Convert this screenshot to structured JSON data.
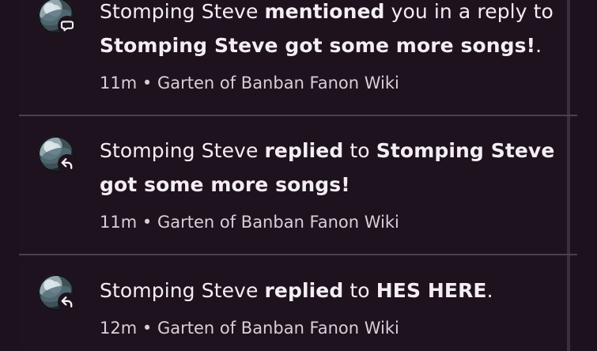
{
  "notifications": [
    {
      "actor": "Stomping Steve",
      "action": "mentioned",
      "middle": "you in a reply to",
      "target": "Stomping Steve got some more songs!",
      "suffix": ".",
      "time": "11m",
      "separator": "•",
      "wiki": "Garten of Banban Fanon Wiki",
      "badge_icon": "speech-bubble-icon"
    },
    {
      "actor": "Stomping Steve",
      "action": "replied",
      "middle": "to",
      "target": "Stomping Steve got some more songs!",
      "suffix": "",
      "time": "11m",
      "separator": "•",
      "wiki": "Garten of Banban Fanon Wiki",
      "badge_icon": "reply-arrow-icon"
    },
    {
      "actor": "Stomping Steve",
      "action": "replied",
      "middle": "to",
      "target": "HES HERE",
      "suffix": ".",
      "time": "12m",
      "separator": "•",
      "wiki": "Garten of Banban Fanon Wiki",
      "badge_icon": "reply-arrow-icon"
    }
  ],
  "colors": {
    "background": "#1c111d",
    "panel": "#1e121f",
    "divider": "#4b404c",
    "text": "#f3eef3",
    "muted_text": "#d8cfd8"
  }
}
